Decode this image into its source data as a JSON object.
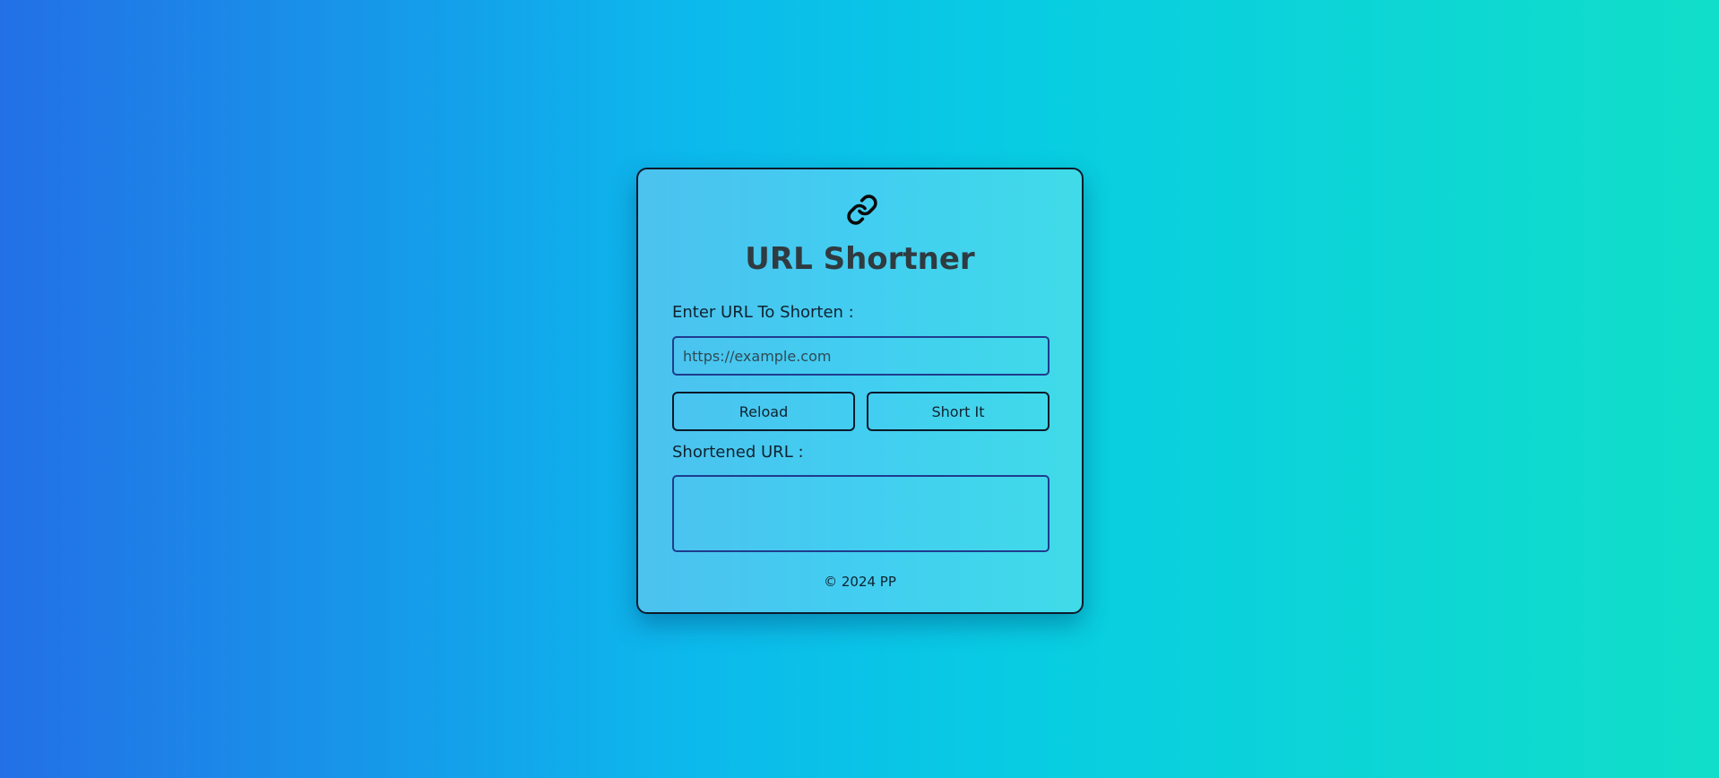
{
  "app": {
    "logo_icon": "link-icon",
    "title": "URL Shortner"
  },
  "form": {
    "input_label": "Enter URL To Shorten :",
    "input_placeholder": "https://example.com",
    "input_value": "",
    "reload_label": "Reload",
    "short_label": "Short It",
    "result_label": "Shortened URL :",
    "result_value": ""
  },
  "footer": {
    "text": "© 2024 PP"
  },
  "colors": {
    "background_start": "#2370e6",
    "background_end": "#11dec9",
    "card_start": "#4cc2ef",
    "card_end": "#40dbe8",
    "title_text": "#2f3b40",
    "input_border": "#1e3c8e"
  }
}
